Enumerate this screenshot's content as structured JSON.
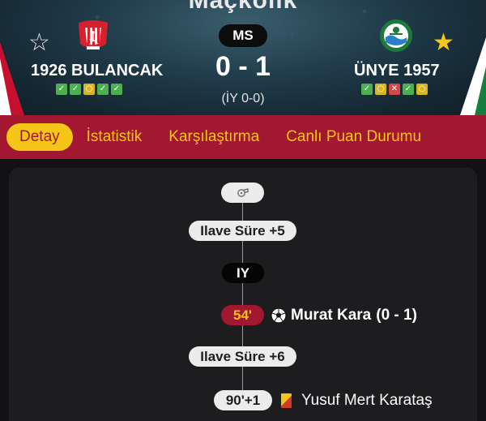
{
  "header": {
    "title_partial": "Maçkolik",
    "status": "MS",
    "score": "0 - 1",
    "halftime": "(İY 0-0)",
    "home": {
      "name": "1926 BULANCAK",
      "favorited": false,
      "star_icon": "star-outline-icon",
      "form": [
        "win",
        "win",
        "draw",
        "win",
        "win"
      ]
    },
    "away": {
      "name": "ÜNYE 1957",
      "favorited": true,
      "star_icon": "star-filled-icon",
      "form": [
        "win",
        "draw",
        "loss",
        "win",
        "draw"
      ]
    },
    "colors": {
      "accent_red": "#a11830",
      "accent_yellow": "#f5c518",
      "win": "#4caf50",
      "draw": "#d9b61e",
      "loss": "#d04848"
    }
  },
  "tabs": {
    "items": [
      {
        "label": "Detay",
        "active": true
      },
      {
        "label": "İstatistik",
        "active": false
      },
      {
        "label": "Karşılaştırma",
        "active": false
      },
      {
        "label": "Canlı Puan Durumu",
        "active": false
      }
    ]
  },
  "timeline": {
    "whistle_icon": "whistle-icon",
    "events": [
      {
        "type": "extra_time",
        "label": "Ilave Süre +5"
      },
      {
        "type": "period",
        "label": "IY"
      },
      {
        "type": "goal",
        "minute": "54'",
        "player": "Murat Kara",
        "score": "(0 - 1)",
        "icon": "soccer-ball-icon",
        "side": "away"
      },
      {
        "type": "extra_time",
        "label": "Ilave Süre +6"
      },
      {
        "type": "yellow_red_card",
        "minute": "90'+1",
        "player": "Yusuf Mert Karataş",
        "icon": "yellow-red-card-icon",
        "side": "away"
      }
    ]
  }
}
